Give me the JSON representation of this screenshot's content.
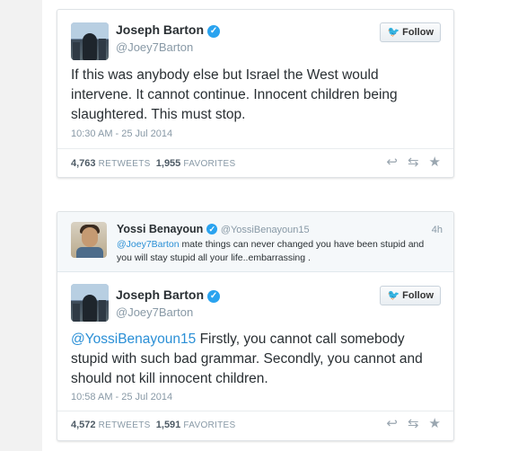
{
  "tweet1": {
    "name": "Joseph Barton",
    "handle": "@Joey7Barton",
    "follow_label": "Follow",
    "text": "If this was anybody else but Israel the West would intervene. It cannot continue. Innocent children being slaughtered. This must stop.",
    "date": "10:30 AM - 25 Jul 2014",
    "retweets": "4,763",
    "retweets_label": "RETWEETS",
    "favorites": "1,955",
    "favorites_label": "FAVORITES"
  },
  "reply_context": {
    "name": "Yossi Benayoun",
    "handle": "@YossiBenayoun15",
    "time": "4h",
    "mention": "@Joey7Barton",
    "text": " mate things can never changed  you have been stupid and you will stay stupid all your life..embarrassing ."
  },
  "tweet2": {
    "name": "Joseph Barton",
    "handle": "@Joey7Barton",
    "follow_label": "Follow",
    "mention": "@YossiBenayoun15",
    "text": " Firstly, you cannot call somebody stupid with such bad grammar. Secondly, you cannot and should not kill innocent children.",
    "date": "10:58 AM - 25 Jul 2014",
    "retweets": "4,572",
    "retweets_label": "RETWEETS",
    "favorites": "1,591",
    "favorites_label": "FAVORITES"
  },
  "colors": {
    "link": "#2a8fd6",
    "verified": "#2aa3ef",
    "text": "#292f33",
    "muted": "#8899a6"
  },
  "icons": {
    "verified": "verified-badge-icon",
    "bird": "twitter-bird-icon",
    "reply": "reply-icon",
    "retweet": "retweet-icon",
    "favorite": "star-icon"
  }
}
